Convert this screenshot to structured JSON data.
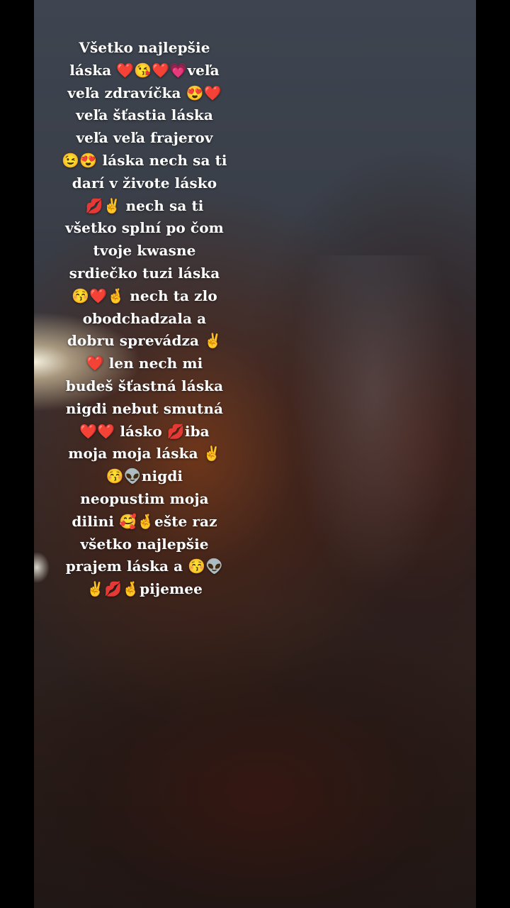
{
  "story": {
    "caption_lines": [
      "Všetko najlepšie",
      "láska ❤️😘❤️💗veľa",
      "veľa zdravíčka 😍❤️",
      "veľa šťastia láska",
      "veľa veľa frajerov",
      "😉😍 láska nech sa ti",
      "darí v živote lásko",
      "💋✌️ nech sa ti",
      "všetko splní po čom",
      "tvoje kwasne",
      "srdiečko tuzi láska",
      "😚❤️🤞 nech ta zlo",
      "obodchadzala a",
      "dobru sprevádza ✌️",
      "❤️ len nech mi",
      "budeš šťastná láska",
      "nigdi nebut smutná",
      "❤️❤️ lásko 💋iba",
      "moja moja láska ✌️",
      "😚👽nigdi",
      "neopustim moja",
      "dilini 🥰🤞ešte raz",
      "všetko najlepšie",
      "prajem láska a 😚👽",
      "✌️💋🤞pijemee"
    ]
  }
}
